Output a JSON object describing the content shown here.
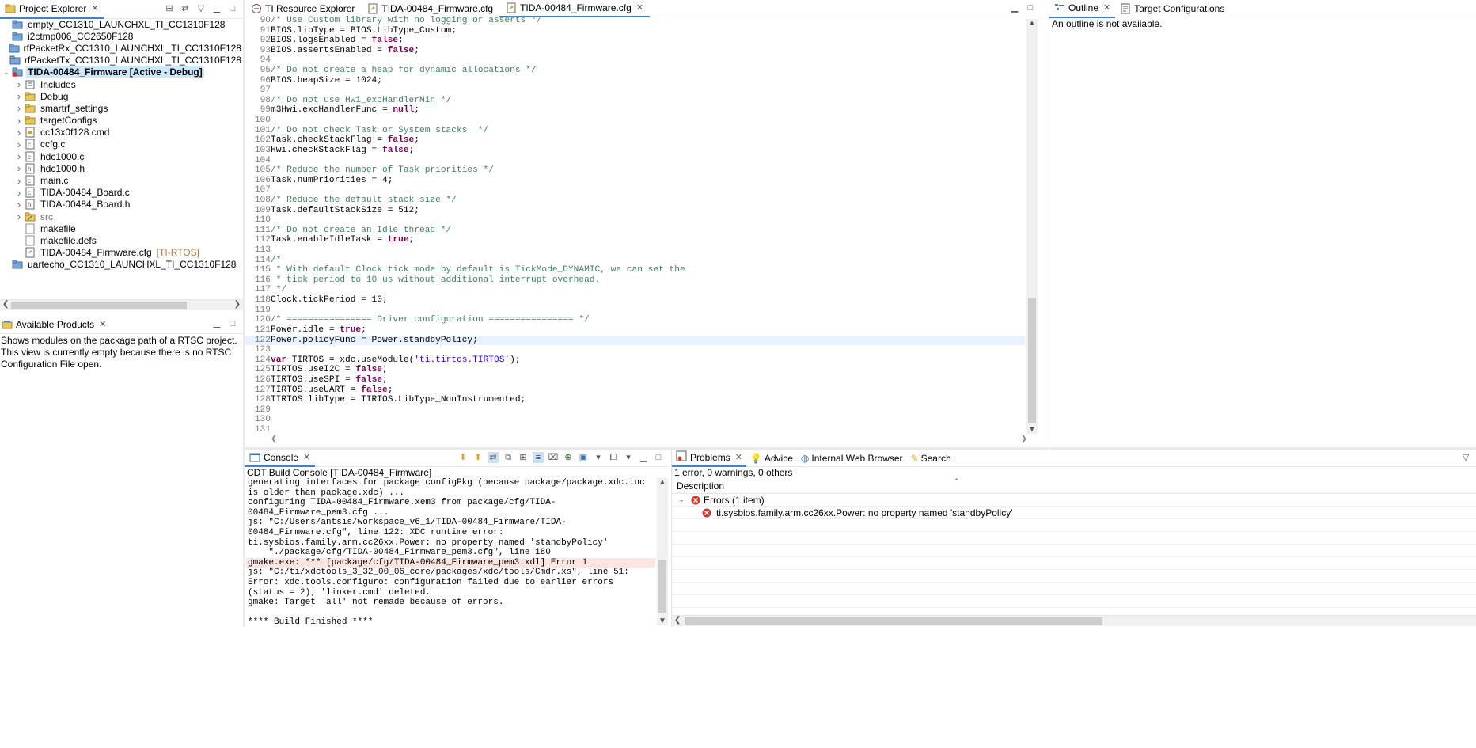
{
  "project_explorer": {
    "tab_label": "Project Explorer",
    "items": [
      {
        "label": "empty_CC1310_LAUNCHXL_TI_CC1310F128",
        "level": 0,
        "expanded": false,
        "icon": "project-folder-icon"
      },
      {
        "label": "i2ctmp006_CC2650F128",
        "level": 0,
        "expanded": false,
        "icon": "project-folder-icon"
      },
      {
        "label": "rfPacketRx_CC1310_LAUNCHXL_TI_CC1310F128",
        "level": 0,
        "expanded": false,
        "icon": "project-folder-icon"
      },
      {
        "label": "rfPacketTx_CC1310_LAUNCHXL_TI_CC1310F128",
        "level": 0,
        "expanded": false,
        "icon": "project-folder-icon"
      },
      {
        "label": "TIDA-00484_Firmware  [Active - Debug]",
        "level": 0,
        "expanded": true,
        "icon": "project-error-icon",
        "selected": true
      },
      {
        "label": "Includes",
        "level": 1,
        "expandable": true,
        "icon": "includes-icon"
      },
      {
        "label": "Debug",
        "level": 1,
        "expandable": true,
        "icon": "folder-icon"
      },
      {
        "label": "smartrf_settings",
        "level": 1,
        "expandable": true,
        "icon": "folder-icon"
      },
      {
        "label": "targetConfigs",
        "level": 1,
        "expandable": true,
        "icon": "folder-icon"
      },
      {
        "label": "cc13x0f128.cmd",
        "level": 1,
        "expandable": true,
        "icon": "cmd-file-icon"
      },
      {
        "label": "ccfg.c",
        "level": 1,
        "expandable": true,
        "icon": "c-file-icon"
      },
      {
        "label": "hdc1000.c",
        "level": 1,
        "expandable": true,
        "icon": "c-file-icon"
      },
      {
        "label": "hdc1000.h",
        "level": 1,
        "expandable": true,
        "icon": "h-file-icon"
      },
      {
        "label": "main.c",
        "level": 1,
        "expandable": true,
        "icon": "c-file-icon"
      },
      {
        "label": "TIDA-00484_Board.c",
        "level": 1,
        "expandable": true,
        "icon": "c-file-icon"
      },
      {
        "label": "TIDA-00484_Board.h",
        "level": 1,
        "expandable": true,
        "icon": "h-file-icon"
      },
      {
        "label": "src",
        "level": 1,
        "expandable": true,
        "icon": "src-folder-icon",
        "muted": true
      },
      {
        "label": "makefile",
        "level": 1,
        "expandable": false,
        "icon": "file-icon"
      },
      {
        "label": "makefile.defs",
        "level": 1,
        "expandable": false,
        "icon": "file-icon"
      },
      {
        "label": "TIDA-00484_Firmware.cfg",
        "level": 1,
        "expandable": false,
        "icon": "cfg-file-icon",
        "decoration": "[TI-RTOS]"
      },
      {
        "label": "uartecho_CC1310_LAUNCHXL_TI_CC1310F128",
        "level": 0,
        "expanded": false,
        "icon": "project-folder-icon"
      }
    ]
  },
  "available_products": {
    "tab_label": "Available Products",
    "message": "Shows modules on the package path of a RTSC project. This view is currently empty because there is no RTSC Configuration File open."
  },
  "editor": {
    "tabs": [
      {
        "label": "TI Resource Explorer",
        "icon": "ti-resource-icon",
        "active": false
      },
      {
        "label": "TIDA-00484_Firmware.cfg",
        "icon": "cfg-file-icon",
        "active": false
      },
      {
        "label": "TIDA-00484_Firmware.cfg",
        "icon": "cfg-file-icon",
        "active": true
      }
    ],
    "lines": [
      {
        "n": "90",
        "t": "/* Use Custom library with no logging or asserts */"
      },
      {
        "n": "91",
        "t": "BIOS.libType = BIOS.LibType_Custom;"
      },
      {
        "n": "92",
        "t": "BIOS.logsEnabled = false;"
      },
      {
        "n": "93",
        "t": "BIOS.assertsEnabled = false;"
      },
      {
        "n": "94",
        "t": ""
      },
      {
        "n": "95",
        "t": "/* Do not create a heap for dynamic allocations */"
      },
      {
        "n": "96",
        "t": "BIOS.heapSize = 1024;"
      },
      {
        "n": "97",
        "t": ""
      },
      {
        "n": "98",
        "t": "/* Do not use Hwi_excHandlerMin */"
      },
      {
        "n": "99",
        "t": "m3Hwi.excHandlerFunc = null;"
      },
      {
        "n": "100",
        "t": ""
      },
      {
        "n": "101",
        "t": "/* Do not check Task or System stacks  */"
      },
      {
        "n": "102",
        "t": "Task.checkStackFlag = false;"
      },
      {
        "n": "103",
        "t": "Hwi.checkStackFlag = false;"
      },
      {
        "n": "104",
        "t": ""
      },
      {
        "n": "105",
        "t": "/* Reduce the number of Task priorities */"
      },
      {
        "n": "106",
        "t": "Task.numPriorities = 4;"
      },
      {
        "n": "107",
        "t": ""
      },
      {
        "n": "108",
        "t": "/* Reduce the default stack size */"
      },
      {
        "n": "109",
        "t": "Task.defaultStackSize = 512;"
      },
      {
        "n": "110",
        "t": ""
      },
      {
        "n": "111",
        "t": "/* Do not create an Idle thread */"
      },
      {
        "n": "112",
        "t": "Task.enableIdleTask = true;"
      },
      {
        "n": "113",
        "t": ""
      },
      {
        "n": "114",
        "t": "/*"
      },
      {
        "n": "115",
        "t": " * With default Clock tick mode by default is TickMode_DYNAMIC, we can set the"
      },
      {
        "n": "116",
        "t": " * tick period to 10 us without additional interrupt overhead."
      },
      {
        "n": "117",
        "t": " */"
      },
      {
        "n": "118",
        "t": "Clock.tickPeriod = 10;"
      },
      {
        "n": "119",
        "t": ""
      },
      {
        "n": "120",
        "t": "/* ================ Driver configuration ================ */"
      },
      {
        "n": "121",
        "t": "Power.idle = true;"
      },
      {
        "n": "122",
        "t": "Power.policyFunc = Power.standbyPolicy;",
        "highlight": true
      },
      {
        "n": "123",
        "t": ""
      },
      {
        "n": "124",
        "t": "var TIRTOS = xdc.useModule('ti.tirtos.TIRTOS');"
      },
      {
        "n": "125",
        "t": "TIRTOS.useI2C = false;"
      },
      {
        "n": "126",
        "t": "TIRTOS.useSPI = false;"
      },
      {
        "n": "127",
        "t": "TIRTOS.useUART = false;"
      },
      {
        "n": "128",
        "t": "TIRTOS.libType = TIRTOS.LibType_NonInstrumented;"
      },
      {
        "n": "129",
        "t": ""
      },
      {
        "n": "130",
        "t": ""
      },
      {
        "n": "131",
        "t": ""
      }
    ]
  },
  "outline": {
    "tabs": [
      {
        "label": "Outline",
        "icon": "outline-icon"
      },
      {
        "label": "Target Configurations",
        "icon": "target-config-icon"
      }
    ],
    "message": "An outline is not available."
  },
  "console": {
    "tab_label": "Console",
    "title": "CDT Build Console [TIDA-00484_Firmware]",
    "lines": [
      {
        "t": "generating interfaces for package configPkg (because package/package.xdc.inc is older than package.xdc) ..."
      },
      {
        "t": "configuring TIDA-00484_Firmware.xem3 from package/cfg/TIDA-00484_Firmware_pem3.cfg ..."
      },
      {
        "t": "js: \"C:/Users/antsis/workspace_v6_1/TIDA-00484_Firmware/TIDA-00484_Firmware.cfg\", line 122: XDC runtime error: ti.sysbios.family.arm.cc26xx.Power: no property named 'standbyPolicy'"
      },
      {
        "t": "    \"./package/cfg/TIDA-00484_Firmware_pem3.cfg\", line 180"
      },
      {
        "t": "gmake.exe: *** [package/cfg/TIDA-00484_Firmware_pem3.xdl] Error 1",
        "error": true
      },
      {
        "t": "js: \"C:/ti/xdctools_3_32_00_06_core/packages/xdc/tools/Cmdr.xs\", line 51: Error: xdc.tools.configuro: configuration failed due to earlier errors (status = 2); 'linker.cmd' deleted."
      },
      {
        "t": "gmake: Target `all' not remade because of errors."
      },
      {
        "t": ""
      },
      {
        "t": "**** Build Finished ****"
      }
    ]
  },
  "problems": {
    "tabs": [
      {
        "label": "Problems",
        "icon": "problems-icon",
        "active": true
      },
      {
        "label": "Advice",
        "icon": "lightbulb-icon"
      },
      {
        "label": "Internal Web Browser",
        "icon": "globe-icon"
      },
      {
        "label": "Search",
        "icon": "search-icon"
      }
    ],
    "summary": "1 error, 0 warnings, 0 others",
    "column_header": "Description",
    "group_label": "Errors (1 item)",
    "error_item": "ti.sysbios.family.arm.cc26xx.Power: no property named 'standbyPolicy'"
  },
  "colors": {
    "comment": "#3f7f5f",
    "keyword": "#7f0055",
    "string": "#2a00ff",
    "error_red": "#d9332a",
    "selection": "#cce8ff",
    "tab_active_underline": "#3c83d4"
  }
}
